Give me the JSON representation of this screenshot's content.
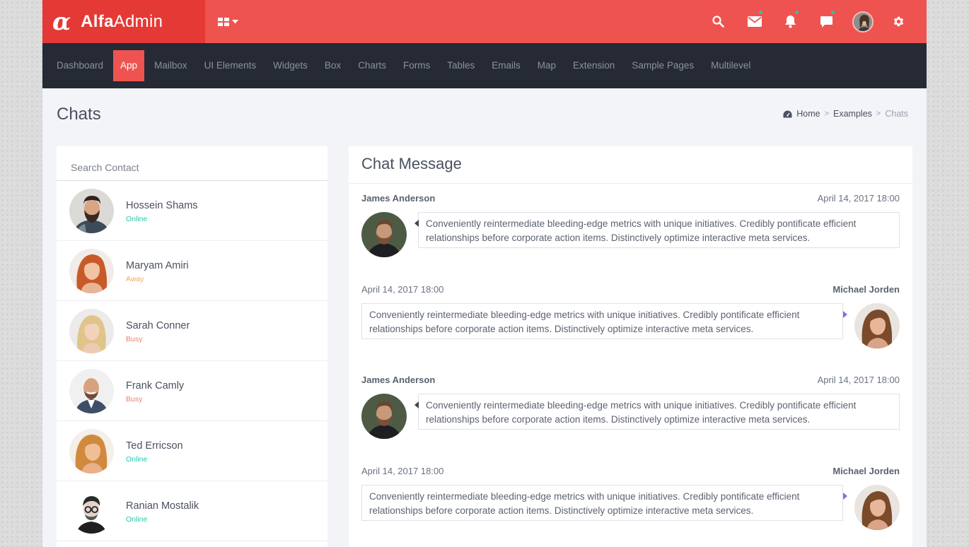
{
  "brand": {
    "logo_mark": "α",
    "name_bold": "Alfa",
    "name_regular": "Admin"
  },
  "topbar": {
    "icons": [
      "search-icon",
      "mail-icon",
      "bell-icon",
      "chat-icon",
      "user-avatar",
      "gear-icon"
    ],
    "notification_dot_color": "#26c6a9",
    "accent": "#ef5350"
  },
  "nav": {
    "items": [
      "Dashboard",
      "App",
      "Mailbox",
      "UI Elements",
      "Widgets",
      "Box",
      "Charts",
      "Forms",
      "Tables",
      "Emails",
      "Map",
      "Extension",
      "Sample Pages",
      "Multilevel"
    ],
    "active": "App"
  },
  "page": {
    "title": "Chats",
    "breadcrumb": {
      "home": "Home",
      "examples": "Examples",
      "current": "Chats"
    }
  },
  "contacts": {
    "search_placeholder": "Search Contact",
    "items": [
      {
        "name": "Hossein Shams",
        "status": "Online",
        "status_color": "#26c6a9"
      },
      {
        "name": "Maryam Amiri",
        "status": "Away",
        "status_color": "#f5a65b"
      },
      {
        "name": "Sarah Conner",
        "status": "Busy",
        "status_color": "#ef7d6b"
      },
      {
        "name": "Frank Camly",
        "status": "Busy",
        "status_color": "#ef7d6b"
      },
      {
        "name": "Ted Erricson",
        "status": "Online",
        "status_color": "#26c6a9"
      },
      {
        "name": "Ranian Mostalik",
        "status": "Online",
        "status_color": "#26c6a9"
      }
    ]
  },
  "chat": {
    "title": "Chat Message",
    "messages": [
      {
        "side": "left",
        "author": "James Anderson",
        "time": "April 14, 2017 18:00",
        "text": "Conveniently reintermediate bleeding-edge metrics with unique initiatives. Credibly pontificate efficient relationships before corporate action items. Distinctively optimize interactive meta services."
      },
      {
        "side": "right",
        "author": "Michael Jorden",
        "time": "April 14, 2017 18:00",
        "text": "Conveniently reintermediate bleeding-edge metrics with unique initiatives. Credibly pontificate efficient relationships before corporate action items. Distinctively optimize interactive meta services."
      },
      {
        "side": "left",
        "author": "James Anderson",
        "time": "April 14, 2017 18:00",
        "text": "Conveniently reintermediate bleeding-edge metrics with unique initiatives. Credibly pontificate efficient relationships before corporate action items. Distinctively optimize interactive meta services."
      },
      {
        "side": "right",
        "author": "Michael Jorden",
        "time": "April 14, 2017 18:00",
        "text": "Conveniently reintermediate bleeding-edge metrics with unique initiatives. Credibly pontificate efficient relationships before corporate action items. Distinctively optimize interactive meta services."
      }
    ]
  }
}
